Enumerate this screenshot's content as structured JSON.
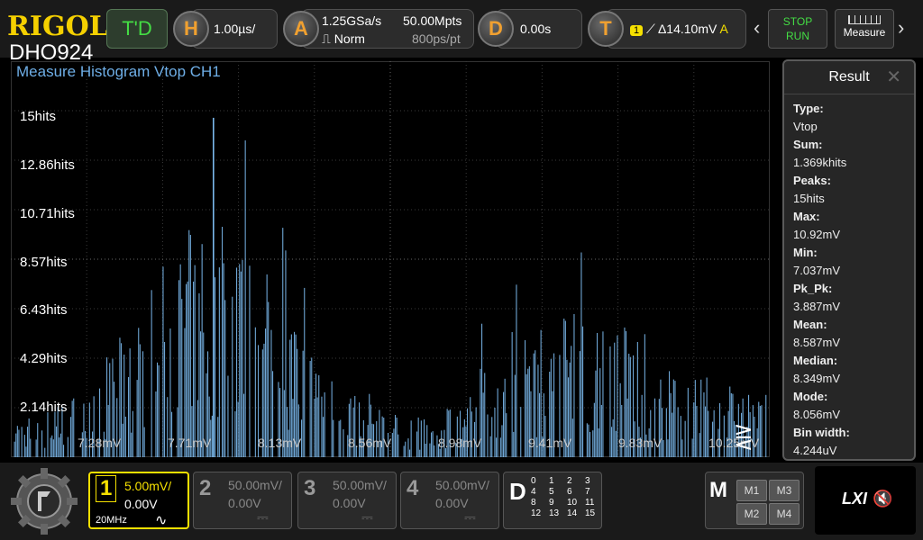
{
  "top": {
    "brand": "RIGOL",
    "model": "DHO924",
    "td_label": "T'D",
    "h_letter": "H",
    "h_value": "1.00µs/",
    "a_letter": "A",
    "a_rate": "1.25GSa/s",
    "a_mode": "Norm",
    "a_depth": "50.00Mpts",
    "a_per_pt": "800ps/pt",
    "d_letter": "D",
    "d_value": "0.00s",
    "t_letter": "T",
    "t_source": "1",
    "t_value": "Δ14.10mV",
    "t_suffix": "A",
    "stop_label": "STOP",
    "run_label": "RUN",
    "measure_label": "Measure"
  },
  "graph": {
    "title": "Measure Histogram  Vtop  CH1"
  },
  "chart_data": {
    "type": "bar",
    "y_tick_labels": [
      "15hits",
      "12.86hits",
      "10.71hits",
      "8.57hits",
      "6.43hits",
      "4.29hits",
      "2.14hits"
    ],
    "y_ticks": [
      15,
      12.86,
      10.71,
      8.57,
      6.43,
      4.29,
      2.14
    ],
    "x_tick_labels": [
      "7.28mV",
      "7.71mV",
      "8.13mV",
      "8.56mV",
      "8.98mV",
      "9.41mV",
      "9.83mV",
      "10.25mV"
    ],
    "ylim": [
      0,
      17.5
    ],
    "xlim": [
      7.037,
      10.92
    ],
    "color": "#7ab8ec",
    "peak": {
      "x": 8.07,
      "y": 15
    }
  },
  "result": {
    "title": "Result",
    "close": "✕",
    "items": [
      {
        "label": "Type:",
        "value": "Vtop"
      },
      {
        "label": "Sum:",
        "value": "1.369khits"
      },
      {
        "label": "Peaks:",
        "value": "15hits"
      },
      {
        "label": "Max:",
        "value": "10.92mV"
      },
      {
        "label": "Min:",
        "value": "7.037mV"
      },
      {
        "label": "Pk_Pk:",
        "value": "3.887mV"
      },
      {
        "label": "Mean:",
        "value": "8.587mV"
      },
      {
        "label": "Median:",
        "value": "8.349mV"
      },
      {
        "label": "Mode:",
        "value": "8.056mV"
      },
      {
        "label": "Bin width:",
        "value": "4.244uV"
      }
    ]
  },
  "channels": [
    {
      "num": "1",
      "scale": "5.00mV/",
      "offset": "0.00V",
      "bw": "20MHz",
      "coupling": "∿",
      "color": "#f5e000",
      "active": true
    },
    {
      "num": "2",
      "scale": "50.00mV/",
      "offset": "0.00V",
      "coupling": "⎓",
      "color": "#888888",
      "active": false
    },
    {
      "num": "3",
      "scale": "50.00mV/",
      "offset": "0.00V",
      "coupling": "⎓",
      "color": "#888888",
      "active": false
    },
    {
      "num": "4",
      "scale": "50.00mV/",
      "offset": "0.00V",
      "coupling": "⎓",
      "color": "#888888",
      "active": false
    }
  ],
  "digital": {
    "letter": "D",
    "channels": [
      "0",
      "1",
      "2",
      "3",
      "4",
      "5",
      "6",
      "7",
      "8",
      "9",
      "10",
      "11",
      "12",
      "13",
      "14",
      "15"
    ]
  },
  "math": {
    "letter": "M",
    "buttons": [
      "M1",
      "M3",
      "M2",
      "M4"
    ]
  },
  "status": {
    "lxi": "LXI",
    "mute_icon": "🔇"
  }
}
